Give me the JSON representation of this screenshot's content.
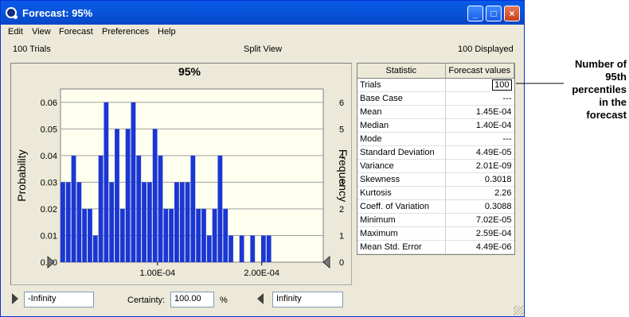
{
  "window": {
    "title": "Forecast: 95%",
    "menu": [
      "Edit",
      "View",
      "Forecast",
      "Preferences",
      "Help"
    ],
    "minimize_label": "_",
    "maximize_label": "□",
    "close_label": "×"
  },
  "info_bar": {
    "trials": "100 Trials",
    "view_mode": "Split View",
    "displayed": "100 Displayed"
  },
  "chart_data": {
    "type": "bar",
    "title": "95%",
    "ylabel": "Probability",
    "y2label": "Frequency",
    "ylim": [
      0,
      0.065
    ],
    "y2lim": [
      0,
      6.5
    ],
    "xlim": [
      7.02e-06,
      0.000259
    ],
    "yticks": [
      "0.00",
      "0.01",
      "0.02",
      "0.03",
      "0.04",
      "0.05",
      "0.06"
    ],
    "y2ticks": [
      "0",
      "1",
      "2",
      "3",
      "4",
      "5",
      "6"
    ],
    "xticks": [
      "1.00E-04",
      "2.00E-04"
    ],
    "xtick_values": [
      0.0001,
      0.0002
    ],
    "bar_width": 5.2e-06,
    "bin_starts": [
      7.02e-06,
      1.222e-05,
      1.742e-05,
      2.262e-05,
      2.782e-05,
      3.302e-05,
      3.822e-05,
      4.342e-05,
      4.862e-05,
      5.382e-05,
      5.902e-05,
      6.422e-05,
      6.942e-05,
      7.462e-05,
      7.982e-05,
      8.502e-05,
      9.022e-05,
      9.542e-05,
      0.00010062,
      0.00010582,
      0.00011102,
      0.00011622,
      0.00012142,
      0.00012662,
      0.00013182,
      0.00013702,
      0.00014222,
      0.00014742,
      0.00015262,
      0.00015782,
      0.00016302,
      0.00016822,
      0.00017342,
      0.00017862,
      0.00018382,
      0.00018902,
      0.00019422,
      0.00019942,
      0.00020462,
      0.00020982,
      0.00021502,
      0.00022022,
      0.00022542,
      0.00023062,
      0.00023582,
      0.00024102,
      0.00024622,
      0.00025142
    ],
    "values": [
      0.03,
      0.03,
      0.04,
      0.03,
      0.02,
      0.02,
      0.01,
      0.04,
      0.06,
      0.03,
      0.05,
      0.02,
      0.05,
      0.06,
      0.04,
      0.03,
      0.03,
      0.05,
      0.04,
      0.02,
      0.02,
      0.03,
      0.03,
      0.03,
      0.04,
      0.02,
      0.02,
      0.01,
      0.02,
      0.04,
      0.02,
      0.01,
      0.0,
      0.01,
      0.0,
      0.01,
      0.0,
      0.01,
      0.01,
      0.0
    ]
  },
  "colors": {
    "bar": "#1a36d4",
    "plot_background": "#fffff0",
    "title_bar": "#0a5ae8"
  },
  "stats": {
    "headers": [
      "Statistic",
      "Forecast values"
    ],
    "rows": [
      {
        "label": "Trials",
        "value": "100"
      },
      {
        "label": "Base Case",
        "value": "---"
      },
      {
        "label": "Mean",
        "value": "1.45E-04"
      },
      {
        "label": "Median",
        "value": "1.40E-04"
      },
      {
        "label": "Mode",
        "value": "---"
      },
      {
        "label": "Standard Deviation",
        "value": "4.49E-05"
      },
      {
        "label": "Variance",
        "value": "2.01E-09"
      },
      {
        "label": "Skewness",
        "value": "0.3018"
      },
      {
        "label": "Kurtosis",
        "value": "2.26"
      },
      {
        "label": "Coeff. of Variation",
        "value": "0.3088"
      },
      {
        "label": "Minimum",
        "value": "7.02E-05"
      },
      {
        "label": "Maximum",
        "value": "2.59E-04"
      },
      {
        "label": "Mean Std. Error",
        "value": "4.49E-06"
      }
    ]
  },
  "certainty": {
    "left_value": "-Infinity",
    "label": "Certainty:",
    "value": "100.00",
    "unit": "%",
    "right_value": "Infinity"
  },
  "annotation": {
    "lines": [
      "Number of",
      "95th percentiles",
      "in the forecast"
    ]
  }
}
